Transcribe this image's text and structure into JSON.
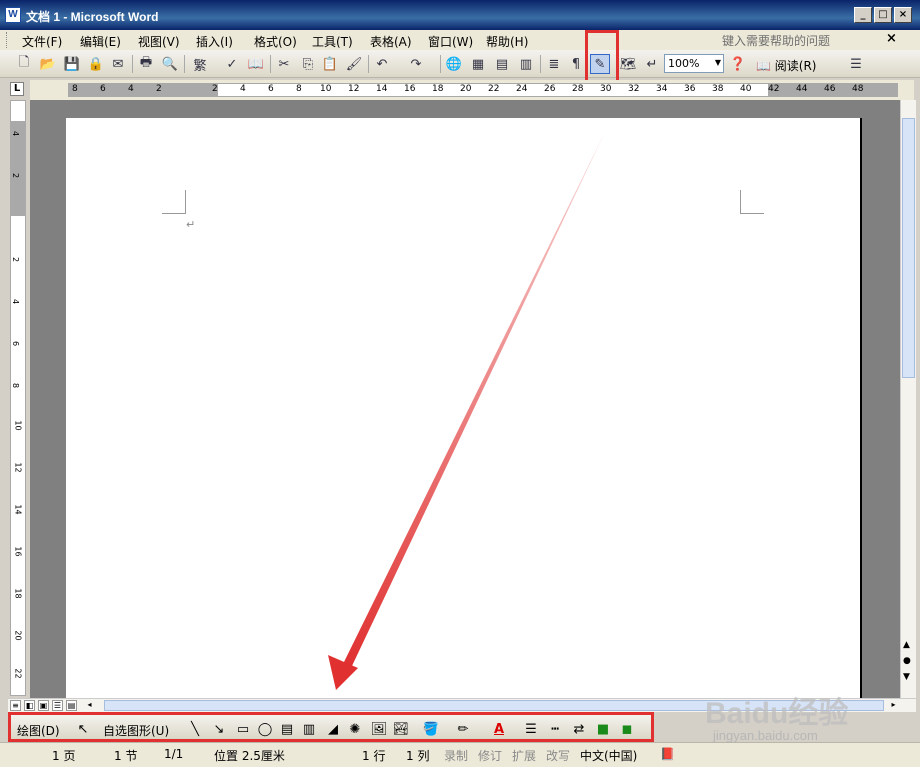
{
  "window": {
    "title": "文档 1 - Microsoft Word",
    "app_icon": "W"
  },
  "menubar": {
    "items": [
      "文件(F)",
      "编辑(E)",
      "视图(V)",
      "插入(I)",
      "格式(O)",
      "工具(T)",
      "表格(A)",
      "窗口(W)",
      "帮助(H)"
    ],
    "help_placeholder": "键入需要帮助的问题"
  },
  "toolbar": {
    "zoom": "100%",
    "read_label": "阅读(R)"
  },
  "ruler": {
    "left_numbers": [
      "8",
      "6",
      "4",
      "2"
    ],
    "right_numbers": [
      "2",
      "4",
      "6",
      "8",
      "10",
      "12",
      "14",
      "16",
      "18",
      "20",
      "22",
      "24",
      "26",
      "28",
      "30",
      "32",
      "34",
      "36",
      "38",
      "40",
      "42",
      "44",
      "46",
      "48"
    ],
    "corner": "L",
    "vertical_numbers": [
      "4",
      "2",
      "2",
      "4",
      "6",
      "8",
      "10",
      "12",
      "14",
      "16",
      "18",
      "20",
      "22"
    ]
  },
  "drawing_toolbar": {
    "draw_label": "绘图(D)",
    "autoshapes_label": "自选图形(U)",
    "font_color_glyph": "A"
  },
  "statusbar": {
    "page": "1 页",
    "section": "1 节",
    "pages": "1/1",
    "position": "位置 2.5厘米",
    "line": "1 行",
    "column": "1 列",
    "rec": "录制",
    "trk": "修订",
    "ext": "扩展",
    "ovr": "改写",
    "language": "中文(中国)"
  },
  "watermark": {
    "logo": "Baidu经验",
    "url": "jingyan.baidu.com"
  },
  "colors": {
    "annotation": "#e03030",
    "titlebar": "#0a246a"
  }
}
